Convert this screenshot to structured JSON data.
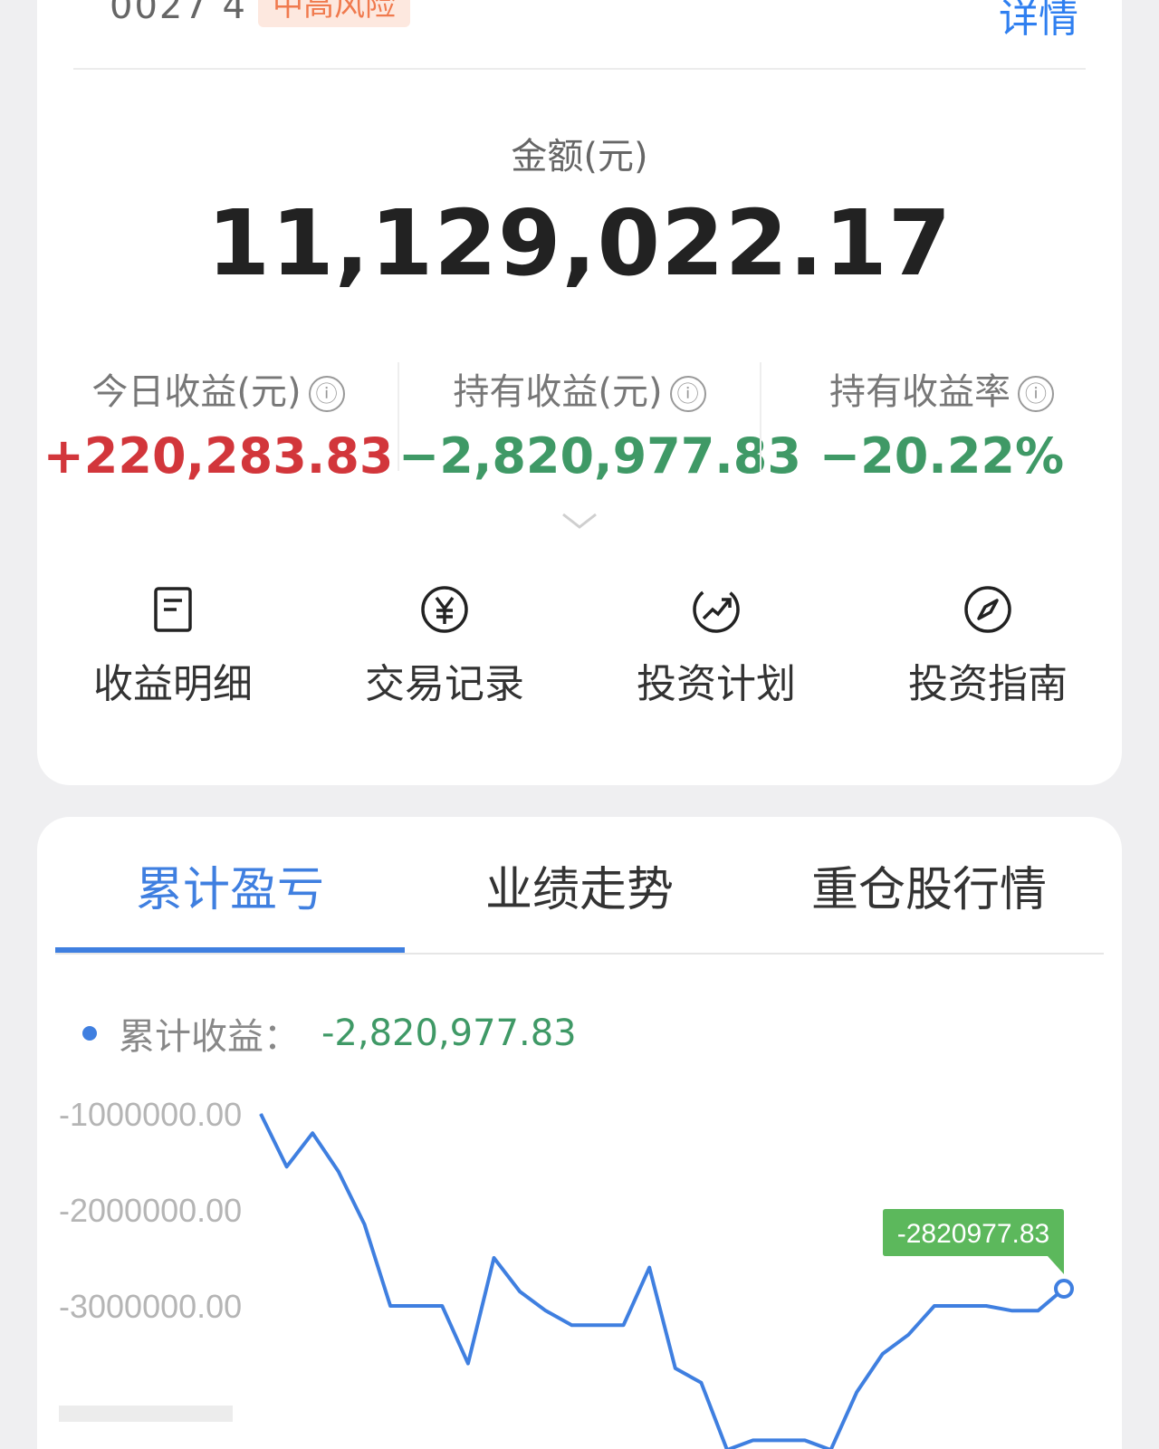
{
  "header_cut": {
    "code": "0027 4",
    "tag": "中高风险",
    "detail_link": "详情"
  },
  "amount": {
    "label": "金额(元)",
    "value": "11,129,022.17"
  },
  "stats": [
    {
      "label": "今日收益(元)",
      "value": "+220,283.83",
      "color": "#d2363b"
    },
    {
      "label": "持有收益(元)",
      "value": "−2,820,977.83",
      "color": "#3f9966"
    },
    {
      "label": "持有收益率",
      "value": "−20.22%",
      "color": "#3f9966"
    }
  ],
  "info_icon": "ⓘ",
  "actions": [
    {
      "label": "收益明细",
      "icon": "document-icon"
    },
    {
      "label": "交易记录",
      "icon": "yuan-icon"
    },
    {
      "label": "投资计划",
      "icon": "trend-icon"
    },
    {
      "label": "投资指南",
      "icon": "compass-icon"
    }
  ],
  "tabs": [
    {
      "label": "累计盈亏",
      "active": true
    },
    {
      "label": "业绩走势",
      "active": false
    },
    {
      "label": "重仓股行情",
      "active": false
    }
  ],
  "legend": {
    "label": "累计收益：",
    "value": "-2,820,977.83"
  },
  "colors": {
    "accent": "#3f7fe0",
    "positive": "#d2363b",
    "negative": "#3f9966",
    "tooltip_bg": "#5cb85c"
  },
  "chart_data": {
    "type": "line",
    "series": [
      {
        "values": [
          -1000000,
          -1550000,
          -1200000,
          -1600000,
          -2150000,
          -3000000,
          -3000000,
          -3000000,
          -3600000,
          -2500000,
          -2850000,
          -3050000,
          -3200000,
          -3200000,
          -3200000,
          -2600000,
          -3650000,
          -3800000,
          -4500000,
          -4400000,
          -4400000,
          -4400000,
          -4500000,
          -3900000,
          -3500000,
          -3300000,
          -3000000,
          -3000000,
          -3000000,
          -3050000,
          -3050000,
          -2820977.83
        ]
      }
    ],
    "yticks": [
      "-1000000.00",
      "-2000000.00",
      "-3000000.00"
    ],
    "ylim": [
      -4000000,
      -1000000
    ],
    "last_label": "-2820977.83"
  }
}
